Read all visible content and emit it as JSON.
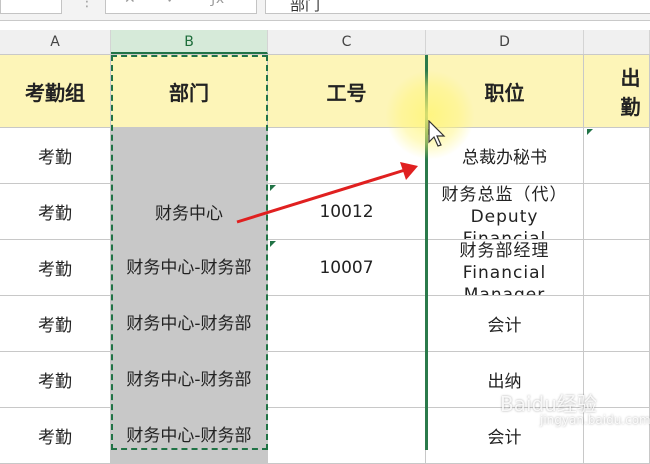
{
  "formula_bar": {
    "cell_content": "部门"
  },
  "columns": [
    {
      "letter": "A",
      "header": "考勤组"
    },
    {
      "letter": "B",
      "header": "部门"
    },
    {
      "letter": "C",
      "header": "工号"
    },
    {
      "letter": "D",
      "header": "职位"
    },
    {
      "letter": "",
      "header": "出勤"
    }
  ],
  "rows": [
    {
      "a": "考勤",
      "b": "",
      "c": "",
      "d": "总裁办秘书",
      "e": ""
    },
    {
      "a": "考勤",
      "b": "财务中心",
      "c": "10012",
      "d": "财务总监（代） Deputy Financial",
      "e": ""
    },
    {
      "a": "考勤",
      "b": "财务中心-财务部",
      "c": "10007",
      "d": "财务部经理 Financial Manager",
      "e": ""
    },
    {
      "a": "考勤",
      "b": "财务中心-财务部",
      "c": "",
      "d": "会计",
      "e": ""
    },
    {
      "a": "考勤",
      "b": "财务中心-财务部",
      "c": "",
      "d": "出纳",
      "e": ""
    },
    {
      "a": "考勤",
      "b": "财务中心-财务部",
      "c": "",
      "d": "会计",
      "e": ""
    }
  ],
  "watermark": {
    "text": "Baidu经验",
    "sub": "jingyan.baidu.com"
  },
  "colors": {
    "header_fill": "#fdf5b8",
    "selected_fill": "#c8c8c8",
    "selection_border": "#217346",
    "arrow": "#e02020",
    "highlight": "#fff578"
  }
}
